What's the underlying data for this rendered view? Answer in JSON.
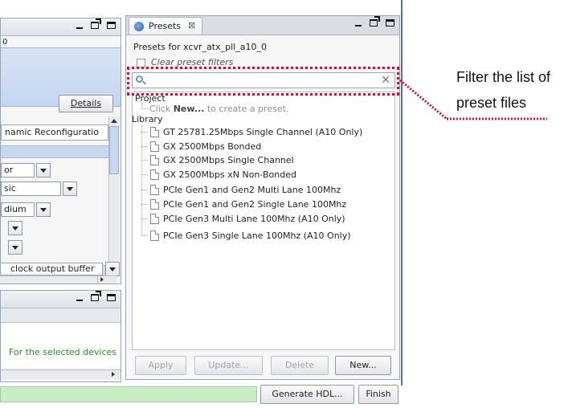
{
  "left_panel": {
    "title_fragment": "0",
    "details_button": "Details",
    "dynamic_reconfig": "namic Reconfiguratio",
    "dropdowns": [
      "or",
      "sic",
      "dium",
      "",
      ""
    ],
    "clock_output": "clock output buffer"
  },
  "message_panel": {
    "message": "For the selected devices"
  },
  "presets": {
    "tab_title": "Presets",
    "tab_close": "⊠",
    "heading": "Presets for xcvr_atx_pll_a10_0",
    "clear_filters_label": "Clear preset filters",
    "search_value": "",
    "project_label": "Project",
    "project_hint_prefix": "Click ",
    "project_hint_bold": "New...",
    "project_hint_suffix": " to create a preset.",
    "library_label": "Library",
    "library_items": [
      "GT 25781.25Mbps Single Channel (A10 Only)",
      "GX 2500Mbps Bonded",
      "GX 2500Mbps Single Channel",
      "GX 2500Mbps xN Non-Bonded",
      "PCIe Gen1 and Gen2 Multi Lane 100Mhz",
      "PCIe Gen1 and Gen2 Single Lane 100Mhz",
      "PCIe Gen3 Multi Lane 100Mhz (A10 Only)",
      "PCIe Gen3 Single Lane 100Mhz (A10 Only)"
    ],
    "buttons": {
      "apply": "Apply",
      "update": "Update...",
      "delete": "Delete",
      "new": "New..."
    }
  },
  "footer": {
    "generate_hdl": "Generate HDL...",
    "finish": "Finish"
  },
  "annotation": {
    "line1": "Filter the list of",
    "line2": "preset files"
  },
  "colors": {
    "annotation_red": "#d0112b",
    "status_green": "#c8ecc3"
  }
}
